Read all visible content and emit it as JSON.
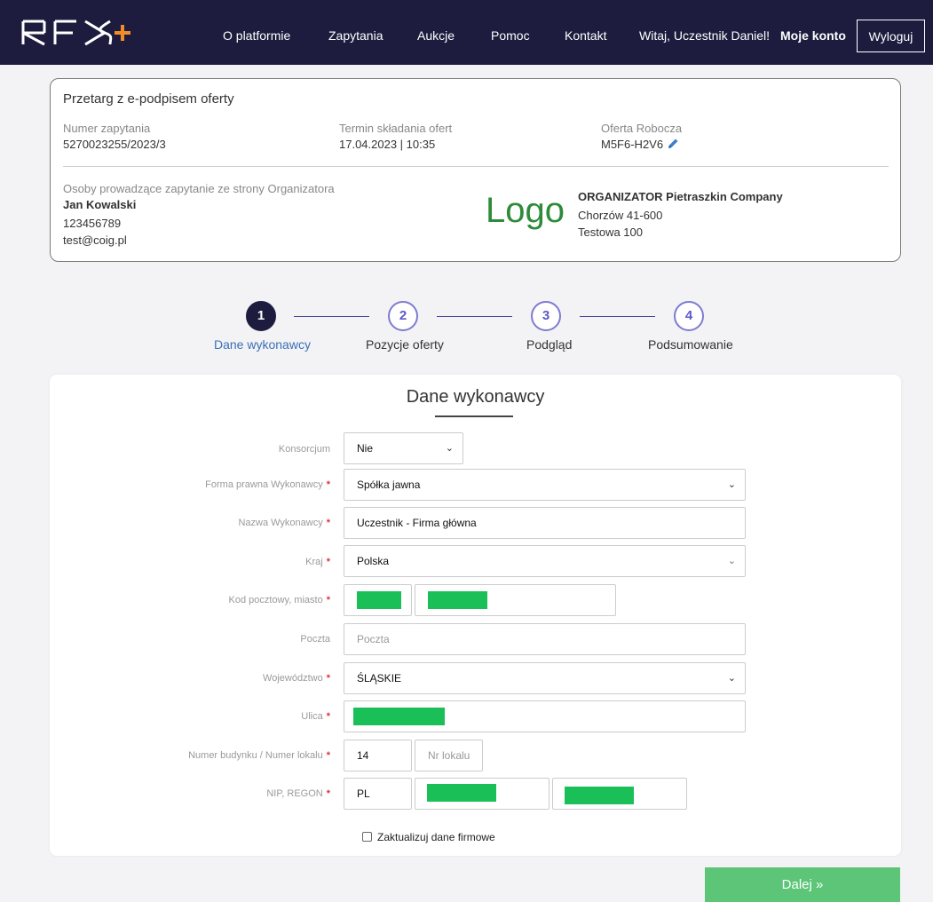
{
  "nav": {
    "brand": "RFX+",
    "links": [
      "O platformie",
      "Zapytania",
      "Aukcje",
      "Pomoc",
      "Kontakt"
    ],
    "greeting": "Witaj, Uczestnik Daniel!",
    "account": "Moje konto",
    "logout": "Wyloguj"
  },
  "info": {
    "title": "Przetarg z e-podpisem oferty",
    "number_label": "Numer zapytania",
    "number_value": "5270023255/2023/3",
    "deadline_label": "Termin składania ofert",
    "deadline_value": "17.04.2023 | 10:35",
    "draft_label": "Oferta Robocza",
    "draft_value": "M5F6-H2V6",
    "contacts_label": "Osoby prowadzące zapytanie ze strony Organizatora",
    "contact_name": "Jan Kowalski",
    "contact_phone": "123456789",
    "contact_email": "test@coig.pl",
    "logo_text": "Logo",
    "organizer_name": "ORGANIZATOR Pietraszkin Company",
    "organizer_city": "Chorzów 41-600",
    "organizer_street": "Testowa 100"
  },
  "steps": [
    {
      "number": "1",
      "label": "Dane wykonawcy",
      "active": true
    },
    {
      "number": "2",
      "label": "Pozycje oferty",
      "active": false
    },
    {
      "number": "3",
      "label": "Podgląd",
      "active": false
    },
    {
      "number": "4",
      "label": "Podsumowanie",
      "active": false
    }
  ],
  "form": {
    "title": "Dane wykonawcy",
    "konsorcjum_label": "Konsorcjum",
    "konsorcjum_value": "Nie",
    "forma_label": "Forma prawna Wykonawcy",
    "forma_value": "Spółka jawna",
    "nazwa_label": "Nazwa Wykonawcy",
    "nazwa_value": "Uczestnik - Firma główna",
    "kraj_label": "Kraj",
    "kraj_value": "Polska",
    "kod_label": "Kod pocztowy, miasto",
    "poczta_label": "Poczta",
    "poczta_placeholder": "Poczta",
    "woj_label": "Województwo",
    "woj_value": "ŚLĄSKIE",
    "ulica_label": "Ulica",
    "numer_label": "Numer budynku / Numer lokalu",
    "numer_value": "14",
    "lokal_placeholder": "Nr lokalu",
    "nip_label": "NIP, REGON",
    "nip_prefix": "PL",
    "update_label": "Zaktualizuj dane firmowe",
    "required_mark": "*"
  },
  "next_button": "Dalej »",
  "colors": {
    "navbar": "#1d1c3f",
    "accent_green": "#5cc578",
    "redaction": "#1bbf58",
    "required": "#d9363e",
    "step_active_label": "#3a6fb7"
  }
}
